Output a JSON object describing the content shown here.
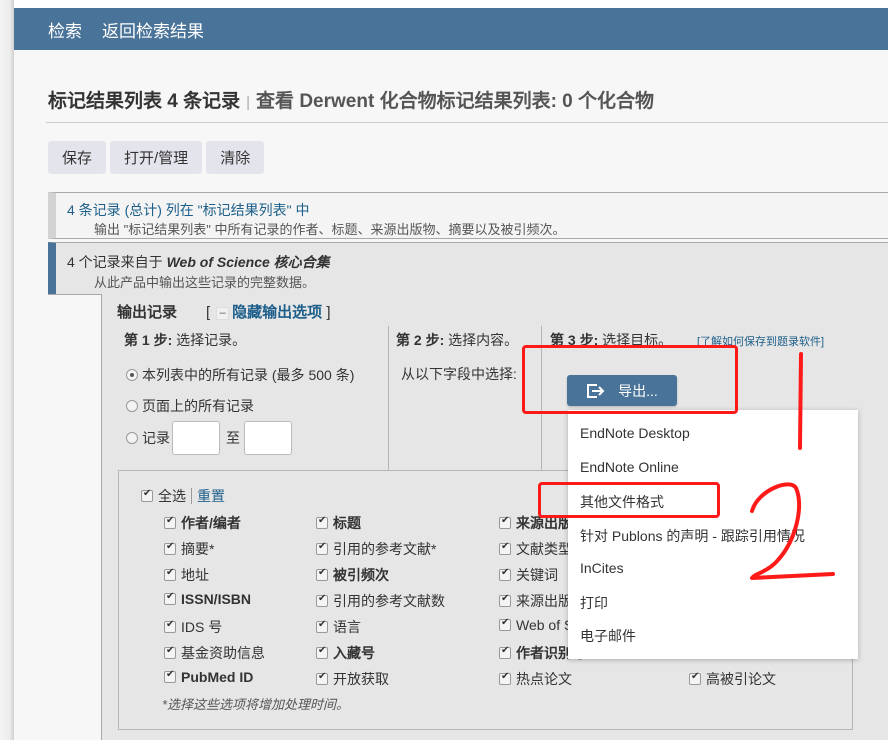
{
  "nav": {
    "items": [
      "检索",
      "返回检索结果"
    ],
    "color": "#4a7399"
  },
  "header": {
    "title": "标记结果列表 4 条记录",
    "separator": "|",
    "subtitle": "查看 Derwent 化合物标记结果列表: 0 个化合物"
  },
  "toolbar": {
    "save_label": "保存",
    "open_manage_label": "打开/管理",
    "clear_label": "清除"
  },
  "summary_box": {
    "line1": "4 条记录 (总计) 列在 \"标记结果列表\" 中",
    "line2": "输出 \"标记结果列表\" 中所有记录的作者、标题、来源出版物、摘要以及被引频次。"
  },
  "wos_box": {
    "line1_prefix": "4 个记录来自于 ",
    "line1_product": "Web of Science 核心合集",
    "line2": "从此产品中输出这些记录的完整数据。"
  },
  "output": {
    "title": "输出记录",
    "toggle_open": "[",
    "toggle_minus": "–",
    "toggle_label": "隐藏输出选项",
    "toggle_close": "]"
  },
  "step1": {
    "bold": "第 1 步:",
    "text": " 选择记录。",
    "options": [
      {
        "label": "本列表中的所有记录 (最多 500 条)",
        "selected": true
      },
      {
        "label": "页面上的所有记录",
        "selected": false
      },
      {
        "label": "记录",
        "selected": false
      }
    ],
    "range_from": "",
    "range_to_label": "至",
    "range_to": ""
  },
  "step2": {
    "bold": "第 2 步:",
    "text": " 选择内容。",
    "hint": "从以下字段中选择:"
  },
  "step3": {
    "bold": "第 3 步:",
    "text": " 选择目标。",
    "learn_link": "[了解如何保存到题录软件]",
    "export_label": "导出..."
  },
  "fields": {
    "select_all": "全选",
    "reset": "重置",
    "columns": [
      [
        {
          "label": "作者/编者",
          "bold": true,
          "checked": true
        },
        {
          "label": "摘要*",
          "bold": false,
          "checked": true
        },
        {
          "label": "地址",
          "bold": false,
          "checked": true
        },
        {
          "label": "ISSN/ISBN",
          "bold": true,
          "checked": true
        },
        {
          "label": "IDS 号",
          "bold": false,
          "checked": true
        },
        {
          "label": "基金资助信息",
          "bold": false,
          "checked": true
        },
        {
          "label": "PubMed ID",
          "bold": true,
          "checked": true
        }
      ],
      [
        {
          "label": "标题",
          "bold": true,
          "checked": true
        },
        {
          "label": "引用的参考文献*",
          "bold": false,
          "checked": true
        },
        {
          "label": "被引频次",
          "bold": true,
          "checked": true
        },
        {
          "label": "引用的参考文献数",
          "bold": false,
          "checked": true
        },
        {
          "label": "语言",
          "bold": false,
          "checked": true
        },
        {
          "label": "入藏号",
          "bold": true,
          "checked": true
        },
        {
          "label": "开放获取",
          "bold": false,
          "checked": true
        }
      ],
      [
        {
          "label": "来源出版物",
          "bold": true,
          "checked": true
        },
        {
          "label": "文献类型",
          "bold": false,
          "checked": true
        },
        {
          "label": "关键词",
          "bold": false,
          "checked": true
        },
        {
          "label": "来源出版物",
          "bold": false,
          "checked": true
        },
        {
          "label": "Web of Science",
          "bold": false,
          "checked": true
        },
        {
          "label": "作者识别号",
          "bold": true,
          "checked": true
        },
        {
          "label": "热点论文",
          "bold": false,
          "checked": true
        }
      ],
      [
        {
          "label": "高被引论文",
          "bold": false,
          "checked": true
        }
      ]
    ],
    "footnote": "*选择这些选项将增加处理时间。"
  },
  "export_menu": {
    "items": [
      "EndNote Desktop",
      "EndNote Online",
      "其他文件格式",
      "针对 Publons 的声明 - 跟踪引用情况",
      "InCites",
      "打印",
      "电子邮件"
    ]
  },
  "annotations": {
    "color": "#ff1a1a",
    "marks": [
      "1",
      "2"
    ]
  }
}
